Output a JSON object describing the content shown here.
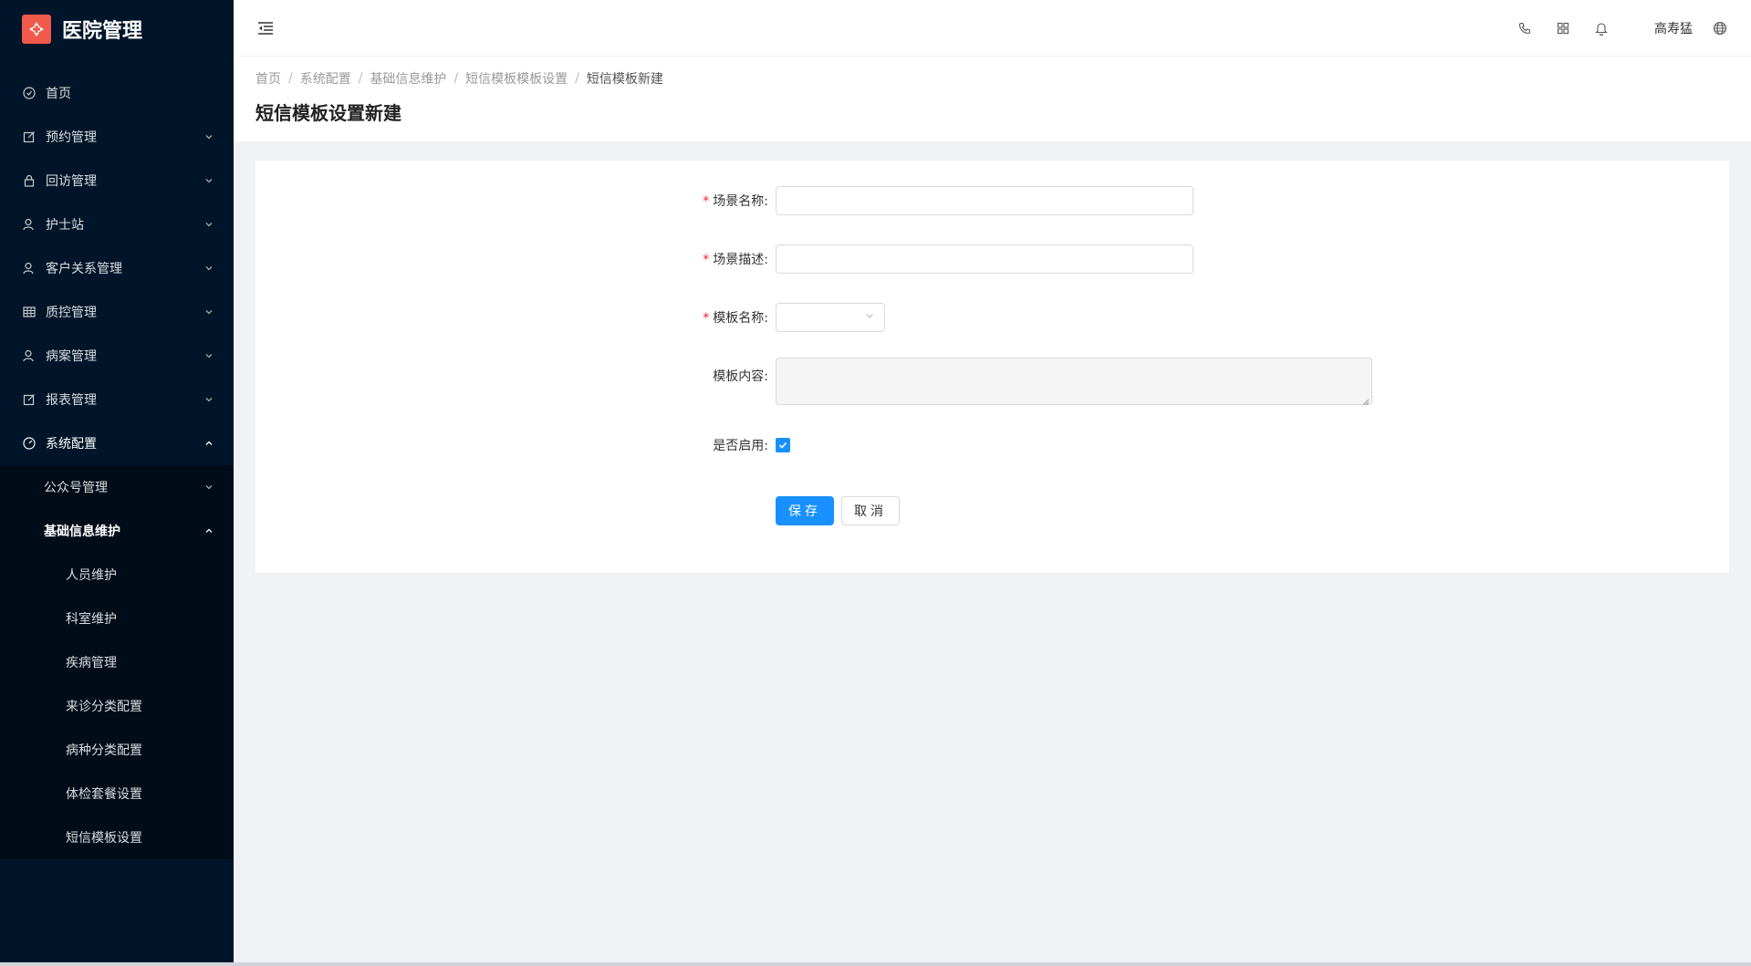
{
  "app": {
    "title": "医院管理"
  },
  "sidebar": {
    "items": [
      {
        "label": "首页",
        "icon": "home-icon"
      },
      {
        "label": "预约管理",
        "icon": "edit-icon"
      },
      {
        "label": "回访管理",
        "icon": "lock-icon"
      },
      {
        "label": "护士站",
        "icon": "user-icon"
      },
      {
        "label": "客户关系管理",
        "icon": "user-icon"
      },
      {
        "label": "质控管理",
        "icon": "table-icon"
      },
      {
        "label": "病案管理",
        "icon": "user-icon"
      },
      {
        "label": "报表管理",
        "icon": "edit-icon"
      },
      {
        "label": "系统配置",
        "icon": "dashboard-icon"
      }
    ],
    "sub_items": [
      {
        "label": "公众号管理"
      },
      {
        "label": "基础信息维护"
      }
    ],
    "leaf_items": [
      {
        "label": "人员维护"
      },
      {
        "label": "科室维护"
      },
      {
        "label": "疾病管理"
      },
      {
        "label": "来诊分类配置"
      },
      {
        "label": "病种分类配置"
      },
      {
        "label": "体检套餐设置"
      },
      {
        "label": "短信模板设置"
      }
    ]
  },
  "header": {
    "user_name": "高寿猛",
    "icons": [
      "phone-icon",
      "apps-icon",
      "bell-icon",
      "globe-icon"
    ]
  },
  "breadcrumb": [
    "首页",
    "系统配置",
    "基础信息维护",
    "短信模板模板设置",
    "短信模板新建"
  ],
  "page": {
    "title": "短信模板设置新建"
  },
  "form": {
    "scene_name_label": "场景名称:",
    "scene_desc_label": "场景描述:",
    "template_name_label": "模板名称:",
    "template_content_label": "模板内容:",
    "enabled_label": "是否启用:",
    "required_mark": "*",
    "scene_name_value": "",
    "scene_desc_value": "",
    "enabled": true,
    "save_label": "保存",
    "cancel_label": "取消"
  },
  "colors": {
    "primary": "#1890ff",
    "sidebar_bg": "#001529",
    "logo": "#f05a4a",
    "required": "#f5222d"
  }
}
